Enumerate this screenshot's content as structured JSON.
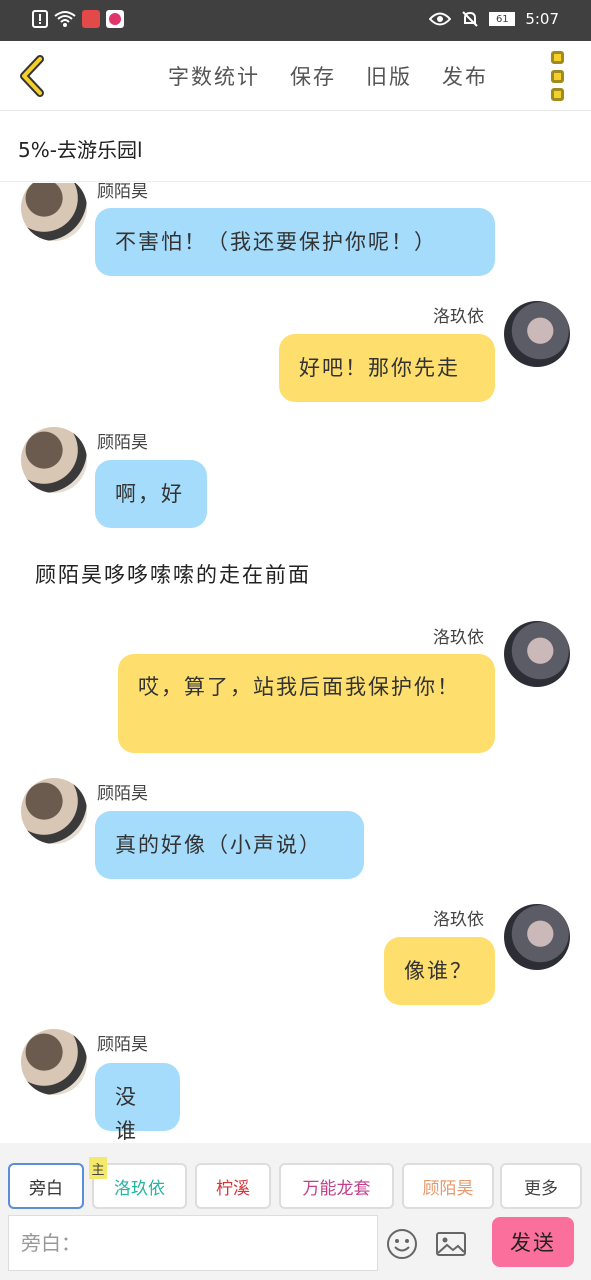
{
  "status_bar": {
    "time": "5:07",
    "battery": "61",
    "icons": [
      "alert-icon",
      "wifi-icon",
      "book-app-icon",
      "app-icon",
      "eye-icon",
      "mute-icon",
      "battery-icon"
    ]
  },
  "app_bar": {
    "menu": [
      "字数统计",
      "保存",
      "旧版",
      "发布"
    ]
  },
  "chapter_title": "5%-去游乐园l",
  "messages": [
    {
      "type": "left",
      "name": "顾陌昊",
      "text": "不害怕！（我还要保护你呢！）"
    },
    {
      "type": "right",
      "name": "洛玖依",
      "text": "好吧！那你先走"
    },
    {
      "type": "left",
      "name": "顾陌昊",
      "text": "啊，好"
    },
    {
      "type": "narration",
      "text": "顾陌昊哆哆嗦嗦的走在前面"
    },
    {
      "type": "right",
      "name": "洛玖依",
      "text": "哎，算了，站我后面我保护你！"
    },
    {
      "type": "left",
      "name": "顾陌昊",
      "text": "真的好像（小声说）"
    },
    {
      "type": "right",
      "name": "洛玖依",
      "text": "像谁？"
    },
    {
      "type": "left",
      "name": "顾陌昊",
      "text": "没谁"
    }
  ],
  "toolbar": {
    "chips": [
      {
        "label": "旁白",
        "color": "#666666"
      },
      {
        "label": "洛玖依",
        "color": "#27b5a0"
      },
      {
        "label": "柠溪",
        "color": "#d9333a"
      },
      {
        "label": "万能龙套",
        "color": "#c2408b"
      },
      {
        "label": "顾陌昊",
        "color": "#e29a6e"
      },
      {
        "label": "更多",
        "color": "#444444"
      }
    ],
    "main_tag": "主",
    "input_placeholder": "旁白：",
    "send_label": "发送"
  }
}
